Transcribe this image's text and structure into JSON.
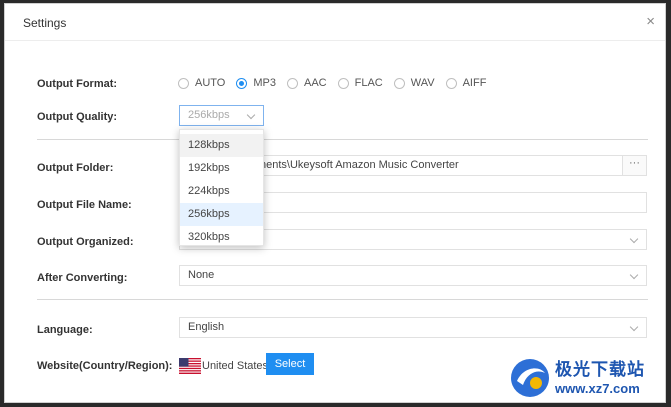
{
  "dialog": {
    "title": "Settings",
    "close_glyph": "×"
  },
  "labels": {
    "output_format": "Output Format:",
    "output_quality": "Output Quality:",
    "output_folder": "Output Folder:",
    "output_file_name": "Output File Name:",
    "output_organized": "Output Organized:",
    "after_converting": "After Converting:",
    "language": "Language:",
    "website": "Website(Country/Region):"
  },
  "output_format": {
    "options": [
      "AUTO",
      "MP3",
      "AAC",
      "FLAC",
      "WAV",
      "AIFF"
    ],
    "selected": "MP3"
  },
  "output_quality": {
    "value": "256kbps",
    "options": [
      "128kbps",
      "192kbps",
      "224kbps",
      "256kbps",
      "320kbps"
    ],
    "hovered": "128kbps"
  },
  "output_folder": {
    "value_visible": "nents\\Ukeysoft Amazon Music Converter",
    "browse_label": "···"
  },
  "output_file_name": {
    "value": ""
  },
  "output_organized": {
    "value": ""
  },
  "after_converting": {
    "value": "None"
  },
  "language": {
    "value": "English"
  },
  "website": {
    "country": "United States",
    "select_label": "Select",
    "flag_icon": "us-flag-icon"
  },
  "watermark": {
    "text": "极光下载站",
    "url": "www.xz7.com"
  },
  "colors": {
    "accent": "#1f8ef1",
    "watermark_blue": "#1e56b0"
  }
}
